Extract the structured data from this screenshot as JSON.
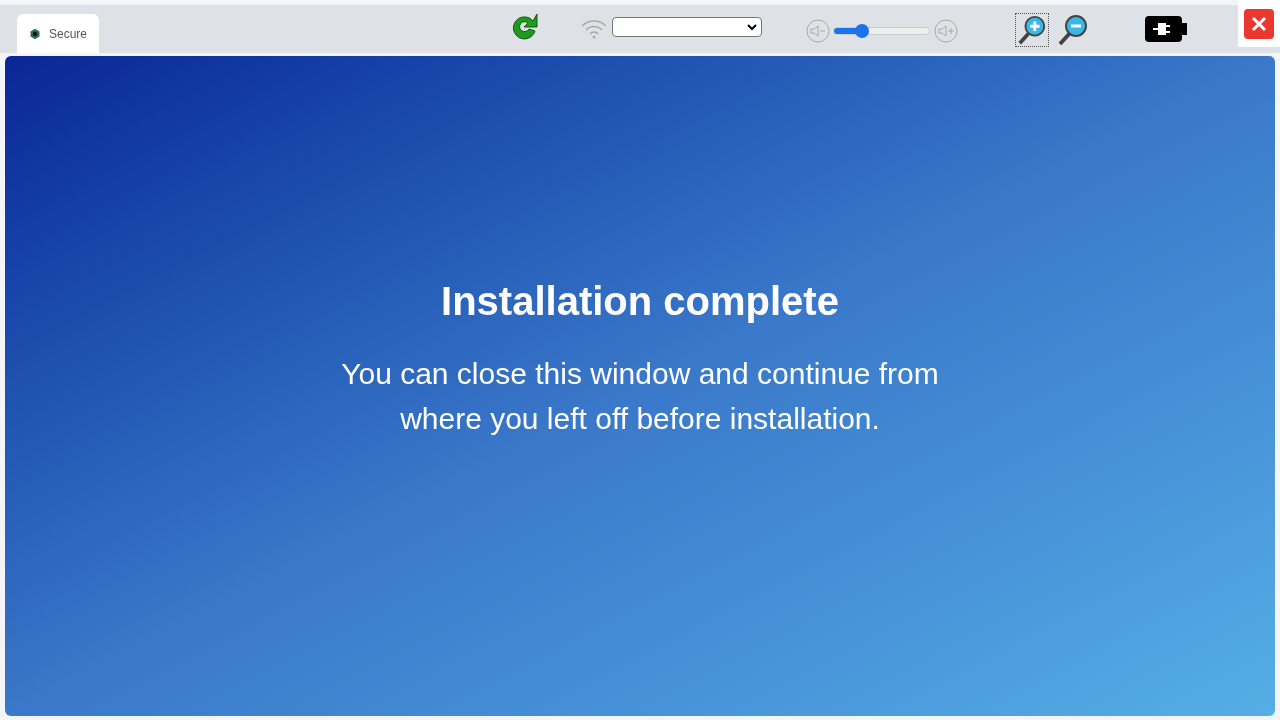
{
  "tab": {
    "title": "Secure",
    "selected": true
  },
  "toolbar": {
    "volume": {
      "level": 0.3
    }
  },
  "content": {
    "heading": "Installation complete",
    "message": "You can close this window and continue from where you left off before installation."
  }
}
